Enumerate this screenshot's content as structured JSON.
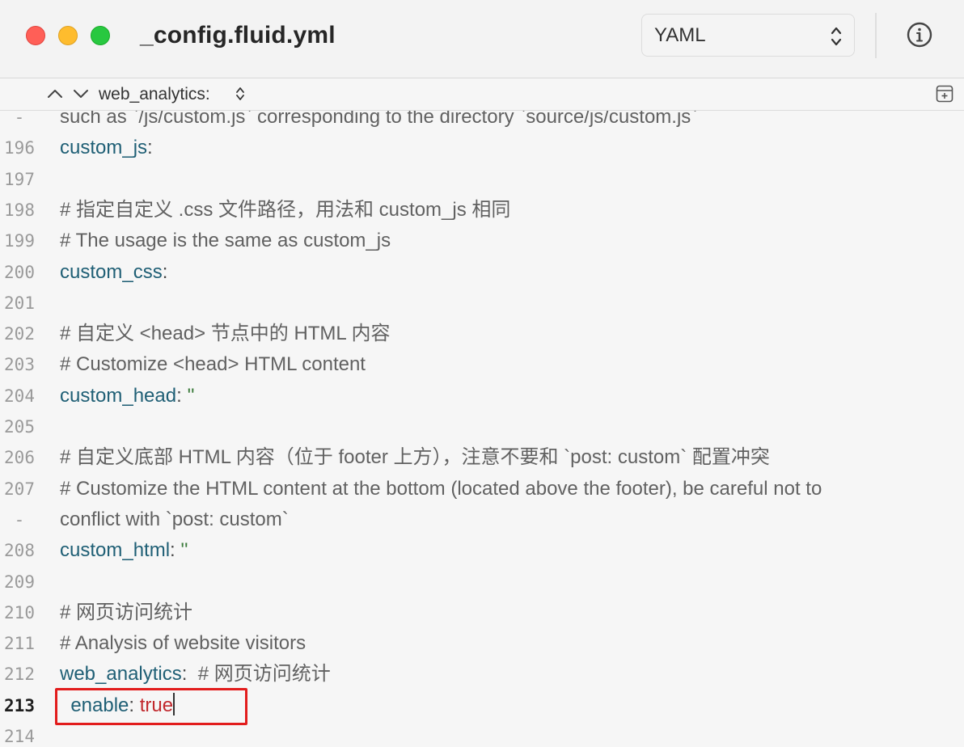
{
  "window": {
    "title": "_config.fluid.yml",
    "language": "YAML"
  },
  "jumpbar": {
    "symbol": "web_analytics:"
  },
  "colors": {
    "key": "#1f5f75",
    "value_true": "#c1282d",
    "highlight": "#e21c1c"
  },
  "editor": {
    "current_line": "213",
    "lines": [
      {
        "num": "-",
        "segments": [
          {
            "t": "such as `/js/custom.js` corresponding to the directory `source/js/custom.js`",
            "c": "comment"
          }
        ]
      },
      {
        "num": "196",
        "segments": [
          {
            "t": "custom_js",
            "c": "key"
          },
          {
            "t": ":",
            "c": "punct"
          }
        ]
      },
      {
        "num": "197",
        "segments": []
      },
      {
        "num": "198",
        "segments": [
          {
            "t": "# 指定自定义 .css 文件路径，用法和 custom_js 相同",
            "c": "comment"
          }
        ]
      },
      {
        "num": "199",
        "segments": [
          {
            "t": "# The usage is the same as custom_js",
            "c": "comment"
          }
        ]
      },
      {
        "num": "200",
        "segments": [
          {
            "t": "custom_css",
            "c": "key"
          },
          {
            "t": ":",
            "c": "punct"
          }
        ]
      },
      {
        "num": "201",
        "segments": []
      },
      {
        "num": "202",
        "segments": [
          {
            "t": "# 自定义 <head> 节点中的 HTML 内容",
            "c": "comment"
          }
        ]
      },
      {
        "num": "203",
        "segments": [
          {
            "t": "# Customize <head> HTML content",
            "c": "comment"
          }
        ]
      },
      {
        "num": "204",
        "segments": [
          {
            "t": "custom_head",
            "c": "key"
          },
          {
            "t": ": ",
            "c": "punct"
          },
          {
            "t": "''",
            "c": "str"
          }
        ]
      },
      {
        "num": "205",
        "segments": []
      },
      {
        "num": "206",
        "segments": [
          {
            "t": "# 自定义底部 HTML 内容（位于 footer 上方），注意不要和 `post: custom` 配置冲突",
            "c": "comment"
          }
        ]
      },
      {
        "num": "207",
        "segments": [
          {
            "t": "# Customize the HTML content at the bottom (located above the footer), be careful not to",
            "c": "comment"
          }
        ]
      },
      {
        "num": "-",
        "segments": [
          {
            "t": "conflict with `post: custom`",
            "c": "comment"
          }
        ]
      },
      {
        "num": "208",
        "segments": [
          {
            "t": "custom_html",
            "c": "key"
          },
          {
            "t": ": ",
            "c": "punct"
          },
          {
            "t": "''",
            "c": "str"
          }
        ]
      },
      {
        "num": "209",
        "segments": []
      },
      {
        "num": "210",
        "segments": [
          {
            "t": "# 网页访问统计",
            "c": "comment"
          }
        ]
      },
      {
        "num": "211",
        "segments": [
          {
            "t": "# Analysis of website visitors",
            "c": "comment"
          }
        ]
      },
      {
        "num": "212",
        "segments": [
          {
            "t": "web_analytics",
            "c": "key"
          },
          {
            "t": ":  ",
            "c": "punct"
          },
          {
            "t": "# 网页访问统计",
            "c": "comment"
          }
        ]
      },
      {
        "num": "213",
        "segments": [
          {
            "t": "  enable",
            "c": "key"
          },
          {
            "t": ": ",
            "c": "punct"
          },
          {
            "t": "true",
            "c": "val"
          }
        ]
      },
      {
        "num": "214",
        "segments": []
      }
    ]
  }
}
